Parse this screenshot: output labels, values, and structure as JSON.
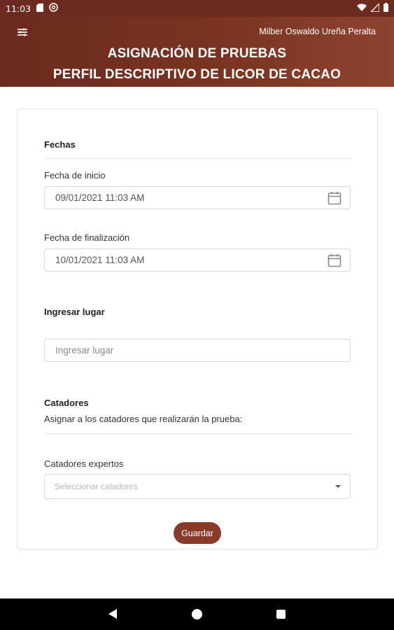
{
  "statusbar": {
    "time": "11:03",
    "icons": [
      "sd-card-icon",
      "at-sign-icon",
      "wifi-icon",
      "signal-icon",
      "battery-icon"
    ]
  },
  "header": {
    "user_name": "Milber Oswaldo Ureña Peralta",
    "title_line1": "ASIGNACIÓN DE PRUEBAS",
    "title_line2": "PERFIL DESCRIPTIVO DE LICOR DE CACAO",
    "gradient_start": "#6b2a1e",
    "gradient_end": "#8e4330"
  },
  "form": {
    "dates_section": "Fechas",
    "start_label": "Fecha de inicio",
    "start_value": "09/01/2021 11:03 AM",
    "end_label": "Fecha de finalización",
    "end_value": "10/01/2021 11:03 AM",
    "place_label": "Ingresar lugar",
    "place_placeholder": "Ingresar lugar",
    "tasters_section": "Catadores",
    "tasters_hint": "Asignar a los catadores que realizarán la prueba:",
    "experts_label": "Catadores expertos",
    "experts_placeholder": "Seleccionar catadores",
    "save_label": "Guardar",
    "accent_color": "#8b3a2a"
  }
}
